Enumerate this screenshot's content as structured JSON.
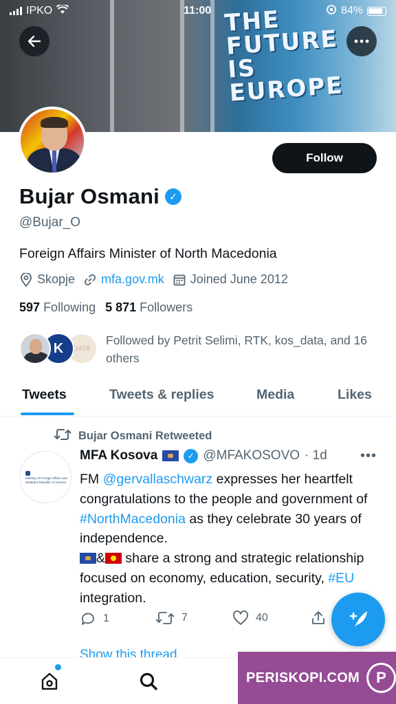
{
  "status_bar": {
    "carrier": "IPKO",
    "time": "11:00",
    "battery": "84%"
  },
  "banner": {
    "mural_lines": [
      "THE",
      "FUTURE",
      "IS",
      "EUROPE"
    ]
  },
  "profile": {
    "name": "Bujar Osmani",
    "handle": "@Bujar_O",
    "bio": "Foreign Affairs Minister of North Macedonia",
    "location": "Skopje",
    "website": "mfa.gov.mk",
    "joined": "Joined June 2012",
    "following_count": "597",
    "following_label": "Following",
    "followers_count": "5 871",
    "followers_label": "Followers",
    "followed_by": "Followed by Petrit Selimi, RTK, kos_data, and 16 others",
    "follow_label": "Follow"
  },
  "tabs": [
    "Tweets",
    "Tweets & replies",
    "Media",
    "Likes"
  ],
  "tweet": {
    "retweet_label": "Bujar Osmani Retweeted",
    "author": "MFA Kosova",
    "handle": "@MFAKOSOVO",
    "time": "· 1d",
    "avatar_text": "Ministry of Foreign Affairs and Diaspora Republic of Kosovo",
    "body": {
      "t1": "FM ",
      "mention": "@gervallaschwarz",
      "t2": " expresses her heartfelt congratulations to the people and government of ",
      "hashtag1": "#NorthMacedonia",
      "t3": " as they celebrate 30 years of independence.",
      "t4": "&",
      "t5": " share a strong and strategic relationship focused on economy, education, security, ",
      "hashtag2": "#EU",
      "t6": " integration."
    },
    "reply_count": "1",
    "retweet_count": "7",
    "like_count": "40",
    "show_thread": "Show this thread"
  },
  "watermark": {
    "text": "PERISKOPI.COM"
  },
  "colors": {
    "accent": "#1d9bf0",
    "text": "#0f1419",
    "muted": "#536471",
    "watermark": "#822d82"
  }
}
